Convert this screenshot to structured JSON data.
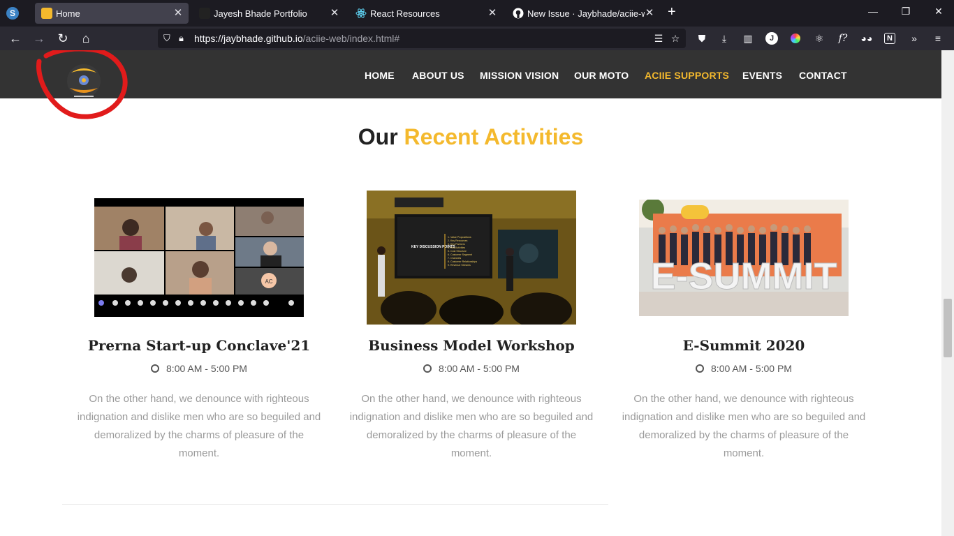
{
  "browser": {
    "tabs": [
      {
        "title": "Home",
        "active": true
      },
      {
        "title": "Jayesh Bhade Portfolio",
        "active": false
      },
      {
        "title": "React Resources",
        "active": false
      },
      {
        "title": "New Issue · Jaybhade/aciie-web",
        "active": false
      }
    ],
    "url_domain": "https://jaybhade.github.io",
    "url_path": "/aciie-web/index.html#"
  },
  "site": {
    "nav": [
      "HOME",
      "ABOUT US",
      "MISSION VISION",
      "OUR MOTO",
      "ACIIE SUPPORTS",
      "EVENTS",
      "CONTACT"
    ],
    "active_nav": "ACIIE SUPPORTS",
    "section_title_a": "Our",
    "section_title_b": "Recent Activities",
    "accent_color": "#f4b92d",
    "cards": [
      {
        "title": "Prerna Start-up Conclave'21",
        "time": "8:00 AM - 5:00 PM",
        "desc": "On the other hand, we denounce with righteous indignation and dislike men who are so beguiled and demoralized by the charms of pleasure of the moment."
      },
      {
        "title": "Business Model Workshop",
        "time": "8:00 AM - 5:00 PM",
        "desc": "On the other hand, we denounce with righteous indignation and dislike men who are so beguiled and demoralized by the charms of pleasure of the moment."
      },
      {
        "title": "E-Summit 2020",
        "time": "8:00 AM - 5:00 PM",
        "desc": "On the other hand, we denounce with righteous indignation and dislike men who are so beguiled and demoralized by the charms of pleasure of the moment."
      }
    ],
    "slide_text": {
      "heading": "KEY DISCUSSION POINTS",
      "points": [
        "1. Value Propositions",
        "2. Key Resources",
        "3. Key Partners",
        "4. Key Activities",
        "5. Cost Structure",
        "6. Customer Segment",
        "7. Channels",
        "8. Customer Relationships",
        "9. Revenue Streams"
      ]
    },
    "summit_sign": "E-SUMMIT",
    "video_avatar": "AC"
  }
}
